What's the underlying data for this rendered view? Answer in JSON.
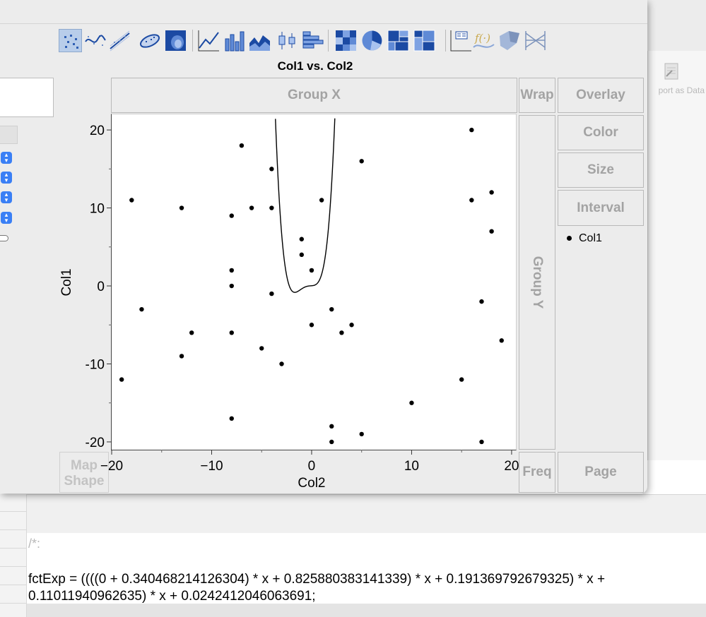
{
  "background": {
    "export_label": "port as Data",
    "comment": "/*:",
    "code_line_1": "fctExp = ((((0 + 0.340468214126304) * x + 0.825880383141339) * x + 0.191369792679325) * x +",
    "code_line_2": "0.11011940962635) * x + 0.0242412046063691;"
  },
  "toolbar": {
    "tools": [
      {
        "name": "points-tool",
        "selected": true
      },
      {
        "name": "smoother-tool"
      },
      {
        "name": "line-of-fit-tool"
      },
      {
        "name": "ellipse-tool"
      },
      {
        "name": "contour-tool"
      },
      {
        "name": "line-tool"
      },
      {
        "name": "bar-tool"
      },
      {
        "name": "area-tool"
      },
      {
        "name": "box-plot-tool"
      },
      {
        "name": "histogram-tool"
      },
      {
        "name": "heatmap-tool"
      },
      {
        "name": "pie-tool"
      },
      {
        "name": "treemap-tool"
      },
      {
        "name": "mosaic-tool"
      },
      {
        "name": "caption-box-tool"
      },
      {
        "name": "formula-tool"
      },
      {
        "name": "map-shapes-tool"
      },
      {
        "name": "parallel-plot-tool"
      }
    ]
  },
  "graph": {
    "title": "Col1 vs. Col2",
    "zones": {
      "group_x": "Group X",
      "wrap": "Wrap",
      "overlay": "Overlay",
      "color": "Color",
      "size": "Size",
      "interval": "Interval",
      "group_y": "Group Y",
      "freq": "Freq",
      "page": "Page",
      "map_shape_1": "Map",
      "map_shape_2": "Shape"
    },
    "legend": {
      "label": "Col1"
    }
  },
  "chart_data": {
    "type": "scatter",
    "title": "Col1 vs. Col2",
    "xlabel": "Col2",
    "ylabel": "Col1",
    "xlim": [
      -20,
      20.5
    ],
    "ylim": [
      -21,
      22
    ],
    "x_ticks": [
      -20,
      -10,
      0,
      10,
      20
    ],
    "y_ticks": [
      -20,
      -10,
      0,
      10,
      20
    ],
    "grid": false,
    "legend": "right",
    "series": [
      {
        "name": "Col1",
        "points": [
          [
            -18,
            11
          ],
          [
            -19,
            -12
          ],
          [
            -17,
            -3
          ],
          [
            -13,
            10
          ],
          [
            -13,
            -9
          ],
          [
            -12,
            -6
          ],
          [
            -8,
            9
          ],
          [
            -8,
            2
          ],
          [
            -8,
            0
          ],
          [
            -8,
            -6
          ],
          [
            -8,
            -17
          ],
          [
            -7,
            18
          ],
          [
            -6,
            10
          ],
          [
            -5,
            -8
          ],
          [
            -4,
            15
          ],
          [
            -4,
            10
          ],
          [
            -4,
            -1
          ],
          [
            -3,
            -10
          ],
          [
            -1,
            6
          ],
          [
            -1,
            4
          ],
          [
            0,
            2
          ],
          [
            0,
            -5
          ],
          [
            1,
            11
          ],
          [
            2,
            -3
          ],
          [
            2,
            -18
          ],
          [
            2,
            -20
          ],
          [
            3,
            -6
          ],
          [
            4,
            -5
          ],
          [
            5,
            16
          ],
          [
            5,
            -19
          ],
          [
            10,
            -15
          ],
          [
            15,
            -12
          ],
          [
            16,
            20
          ],
          [
            16,
            11
          ],
          [
            17,
            -2
          ],
          [
            17,
            -20
          ],
          [
            18,
            12
          ],
          [
            18,
            7
          ],
          [
            19,
            -7
          ]
        ]
      }
    ],
    "fit_curve": {
      "name": "fctExp",
      "coefficients": [
        0.340468214126304,
        0.825880383141339,
        0.191369792679325,
        0.11011940962635,
        0.0242412046063691
      ]
    }
  }
}
